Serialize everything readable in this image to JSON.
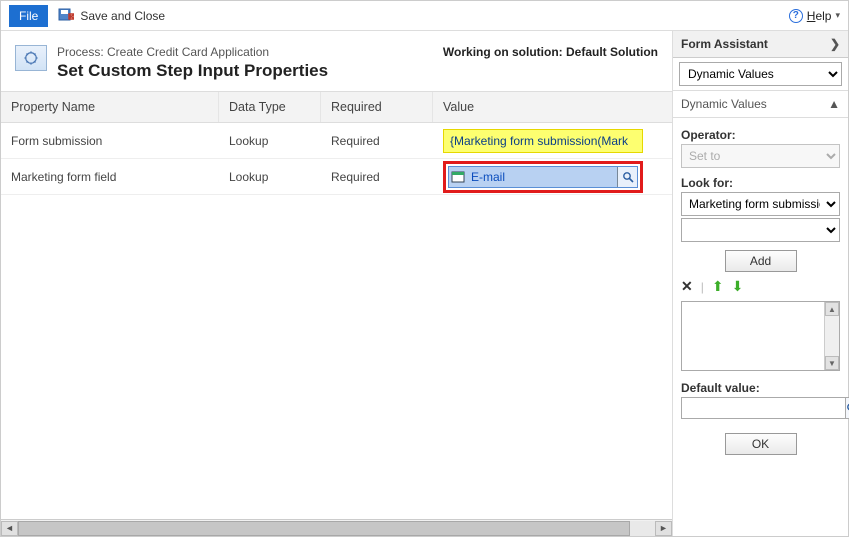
{
  "toolbar": {
    "file": "File",
    "save_close": "Save and Close",
    "help": "Help"
  },
  "header": {
    "process_prefix": "Process: ",
    "process_name": "Create Credit Card Application",
    "title": "Set Custom Step Input Properties",
    "working_on_prefix": "Working on solution: ",
    "solution_name": "Default Solution"
  },
  "grid": {
    "cols": {
      "name": "Property Name",
      "type": "Data Type",
      "req": "Required",
      "val": "Value"
    },
    "rows": [
      {
        "name": "Form submission",
        "type": "Lookup",
        "req": "Required",
        "value": "{Marketing form submission(Mark"
      },
      {
        "name": "Marketing form field",
        "type": "Lookup",
        "req": "Required",
        "value": "E-mail"
      }
    ]
  },
  "assistant": {
    "title": "Form Assistant",
    "mode": "Dynamic Values",
    "section": "Dynamic Values",
    "operator_label": "Operator:",
    "operator_value": "Set to",
    "lookfor_label": "Look for:",
    "lookfor_value": "Marketing form submission",
    "add_btn": "Add",
    "default_label": "Default value:",
    "ok_btn": "OK"
  }
}
